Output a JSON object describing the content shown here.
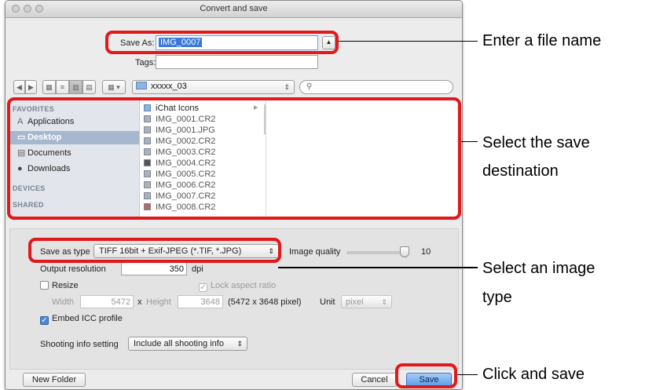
{
  "window": {
    "title": "Convert and save"
  },
  "save_as": {
    "label": "Save As:",
    "value": "IMG_0007",
    "tags_label": "Tags:",
    "expand_symbol": "▲"
  },
  "toolbar": {
    "folder_name": "xxxxx_03",
    "search_placeholder": ""
  },
  "sidebar": {
    "favorites_header": "FAVORITES",
    "items": [
      {
        "label": "Applications",
        "icon": "applications-icon"
      },
      {
        "label": "Desktop",
        "icon": "desktop-icon"
      },
      {
        "label": "Documents",
        "icon": "documents-icon"
      },
      {
        "label": "Downloads",
        "icon": "downloads-icon"
      }
    ],
    "devices_header": "DEVICES",
    "shared_header": "SHARED"
  },
  "files": [
    "iChat Icons",
    "IMG_0001.CR2",
    "IMG_0001.JPG",
    "IMG_0002.CR2",
    "IMG_0003.CR2",
    "IMG_0004.CR2",
    "IMG_0005.CR2",
    "IMG_0006.CR2",
    "IMG_0007.CR2",
    "IMG_0008.CR2"
  ],
  "options": {
    "save_as_type_label": "Save as type",
    "save_as_type_value": "TIFF 16bit + Exif-JPEG (*.TIF, *.JPG)",
    "image_quality_label": "Image quality",
    "image_quality_value": "10",
    "image_quality_fraction": 1.0,
    "output_resolution_label": "Output resolution",
    "output_resolution_value": "350",
    "output_resolution_unit": "dpi",
    "resize_label": "Resize",
    "lock_aspect_label": "Lock aspect ratio",
    "width_label": "Width",
    "width_value": "5472",
    "x_label": "x",
    "height_label": "Height",
    "height_value": "3648",
    "size_text": "(5472 x 3648 pixel)",
    "unit_label": "Unit",
    "unit_value": "pixel",
    "embed_icc_label": "Embed ICC profile",
    "shooting_info_label": "Shooting info setting",
    "shooting_info_value": "Include all shooting info"
  },
  "buttons": {
    "new_folder": "New Folder",
    "cancel": "Cancel",
    "save": "Save"
  },
  "annotations": {
    "file_name": "Enter a file name",
    "destination_line1": "Select the save",
    "destination_line2": "destination",
    "image_type_line1": "Select an image",
    "image_type_line2": "type",
    "save": "Click and save"
  },
  "colors": {
    "highlight": "#e0191c",
    "selection": "#3b78d6",
    "save_button": "#5a9be8"
  }
}
